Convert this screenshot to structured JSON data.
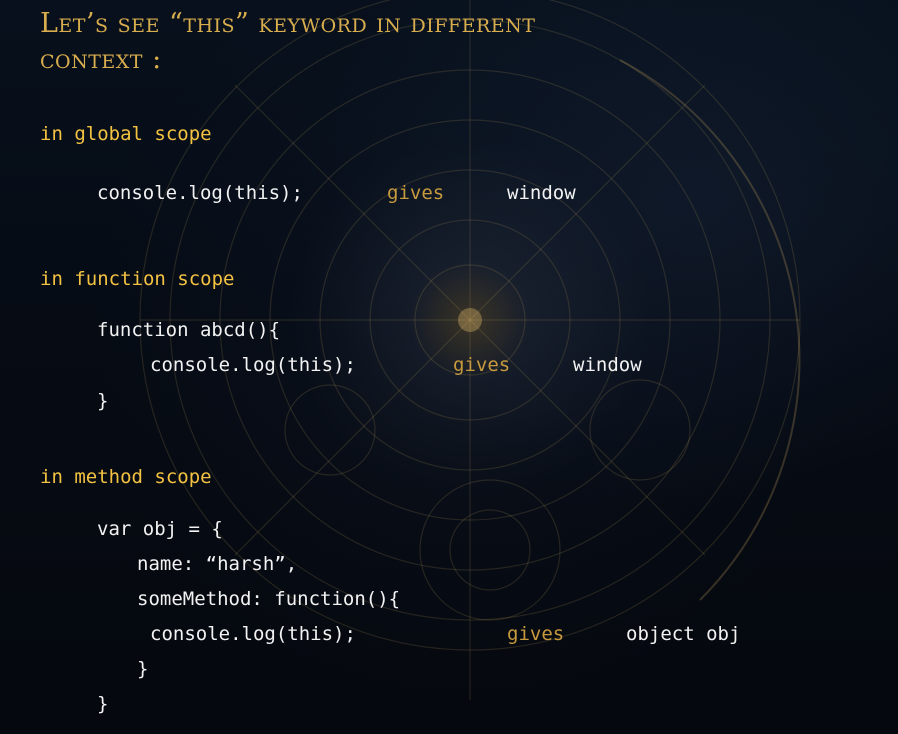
{
  "title": {
    "line1": "Let’s see “this” keyword in different",
    "line2": "context :"
  },
  "sections": {
    "global": {
      "heading": "in global scope",
      "code": "console.log(this);",
      "gives": "gives",
      "result": "window"
    },
    "function": {
      "heading": "in function scope",
      "line1": "function abcd(){",
      "line2": "console.log(this);",
      "gives": "gives",
      "result": "window",
      "line3": "}"
    },
    "method": {
      "heading": "in method scope",
      "line1": "var obj = {",
      "line2": "name: “harsh”,",
      "line3": "someMethod: function(){",
      "line4": "console.log(this);",
      "gives": "gives",
      "result": "object obj",
      "line5": "}",
      "line6": "}"
    }
  },
  "colors": {
    "title": "#d8ad4e",
    "heading": "#f4c242",
    "gives": "#c89a3e",
    "code": "#f2f2f2",
    "background": "#05080e"
  }
}
